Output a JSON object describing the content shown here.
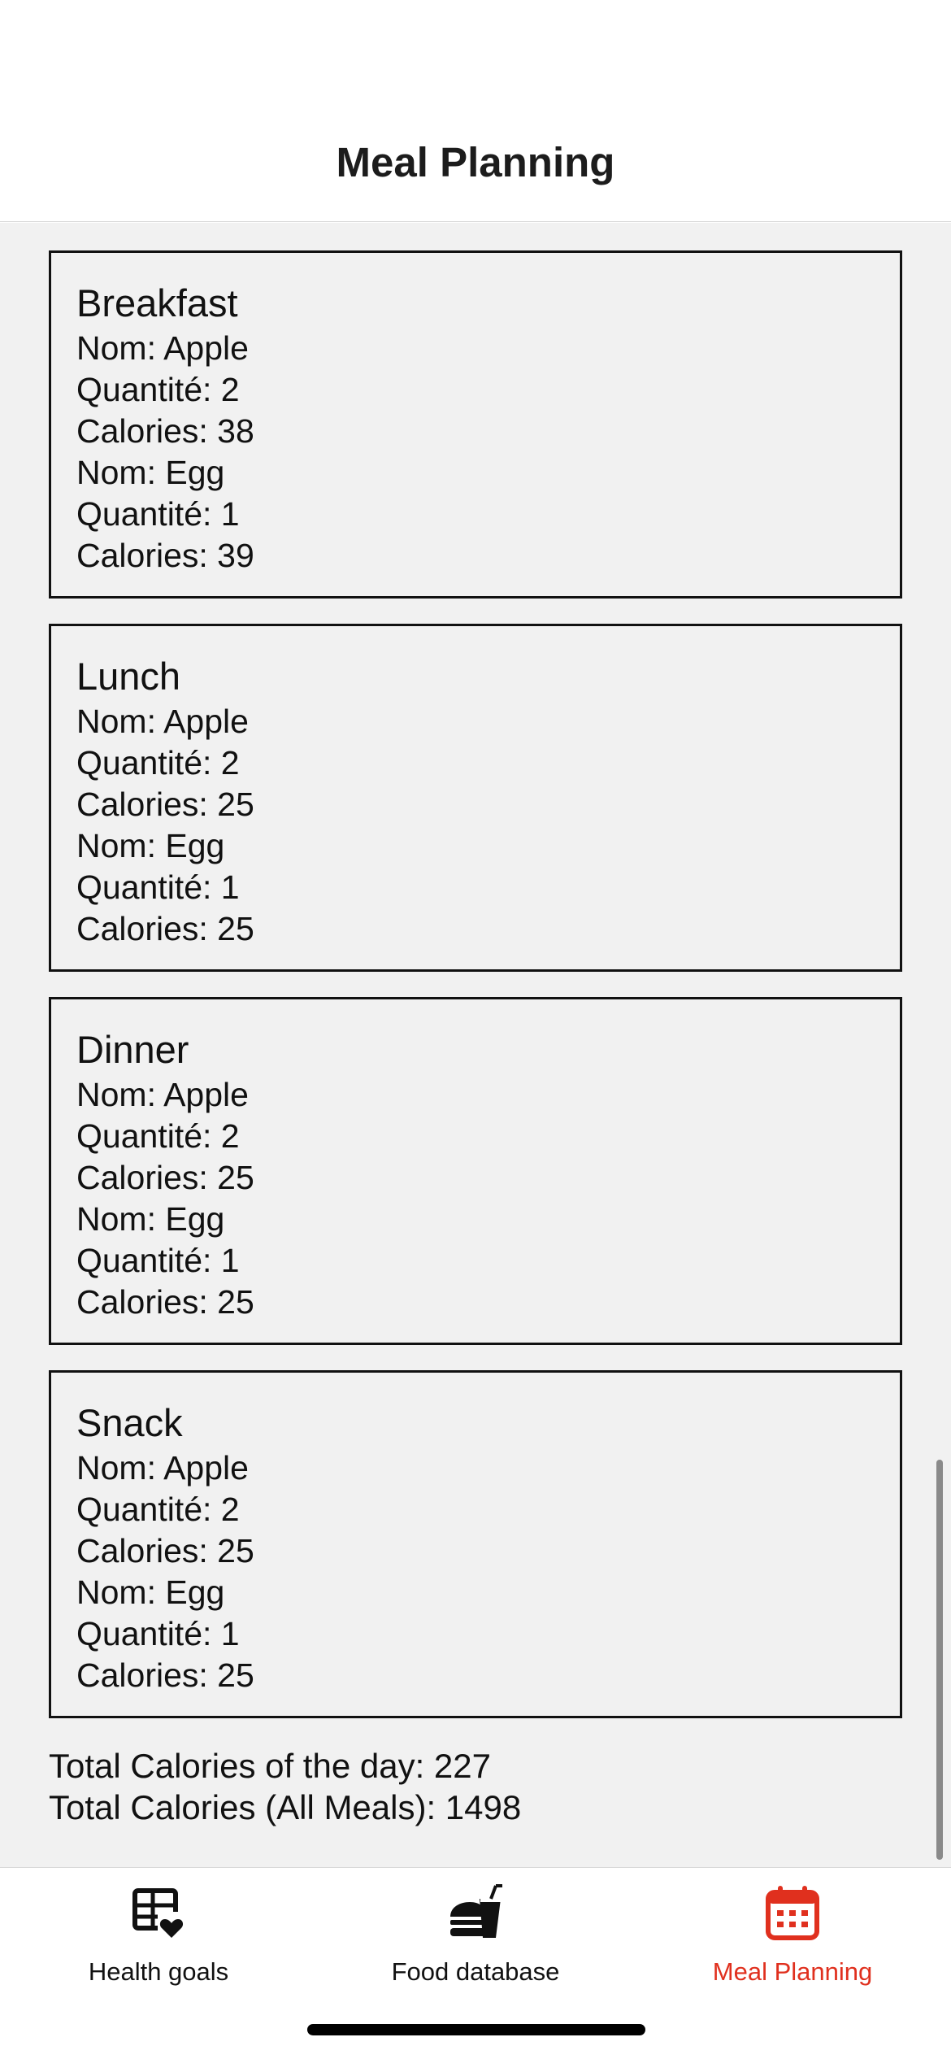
{
  "header": {
    "title": "Meal Planning"
  },
  "meals": [
    {
      "name": "Breakfast",
      "lines": [
        "Nom: Apple",
        "Quantité: 2",
        "Calories: 38",
        "Nom: Egg",
        "Quantité: 1",
        "Calories: 39"
      ]
    },
    {
      "name": "Lunch",
      "lines": [
        "Nom: Apple",
        "Quantité: 2",
        "Calories: 25",
        "Nom: Egg",
        "Quantité: 1",
        "Calories: 25"
      ]
    },
    {
      "name": "Dinner",
      "lines": [
        "Nom: Apple",
        "Quantité: 2",
        "Calories: 25",
        "Nom: Egg",
        "Quantité: 1",
        "Calories: 25"
      ]
    },
    {
      "name": "Snack",
      "lines": [
        "Nom: Apple",
        "Quantité: 2",
        "Calories: 25",
        "Nom: Egg",
        "Quantité: 1",
        "Calories: 25"
      ]
    }
  ],
  "totals": {
    "day": "Total Calories of the day: 227",
    "all_meals": "Total Calories (All Meals): 1498"
  },
  "tabs": [
    {
      "label": "Health goals",
      "icon": "health-goals-icon",
      "active": false
    },
    {
      "label": "Food database",
      "icon": "food-database-icon",
      "active": false
    },
    {
      "label": "Meal Planning",
      "icon": "calendar-icon",
      "active": true
    }
  ],
  "colors": {
    "accent": "#e0301e",
    "background": "#f1f1f1",
    "text": "#111111"
  }
}
